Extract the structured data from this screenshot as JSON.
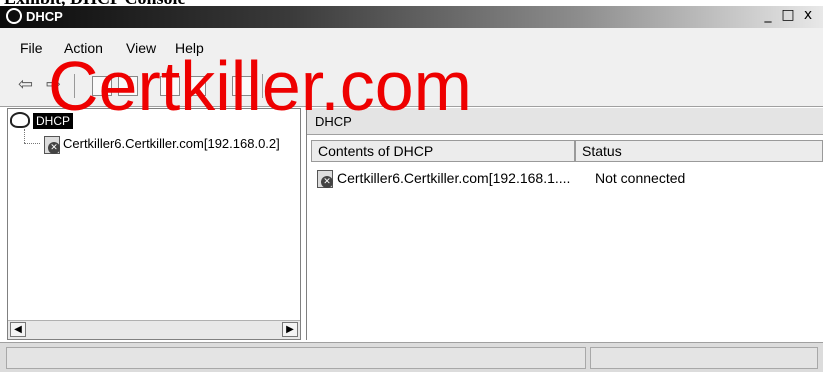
{
  "caption": "Exhibit, DHCP Console",
  "window": {
    "title": "DHCP",
    "controls": [
      "_",
      "□",
      "x"
    ]
  },
  "menu": [
    {
      "label": "File",
      "underline": "F"
    },
    {
      "label": "Action",
      "underline": "A"
    },
    {
      "label": "View",
      "underline": "V"
    },
    {
      "label": "Help",
      "underline": "H"
    }
  ],
  "toolbar": {
    "back_icon": "back-arrow-icon",
    "forward_icon": "forward-arrow-icon",
    "back_glyph": "⇦",
    "forward_glyph": "⇨"
  },
  "watermark": "Certkiller.com",
  "tree": {
    "root_label": "DHCP",
    "child_label": "Certkiller6.Certkiller.com[192.168.0.2]"
  },
  "content": {
    "header": "DHCP",
    "columns": [
      "Contents of DHCP",
      "Status"
    ],
    "rows": [
      {
        "name": "Certkiller6.Certkiller.com[192.168.1....",
        "status": "Not connected"
      }
    ]
  },
  "scroll": {
    "left_arrow": "◀",
    "right_arrow": "▶"
  }
}
